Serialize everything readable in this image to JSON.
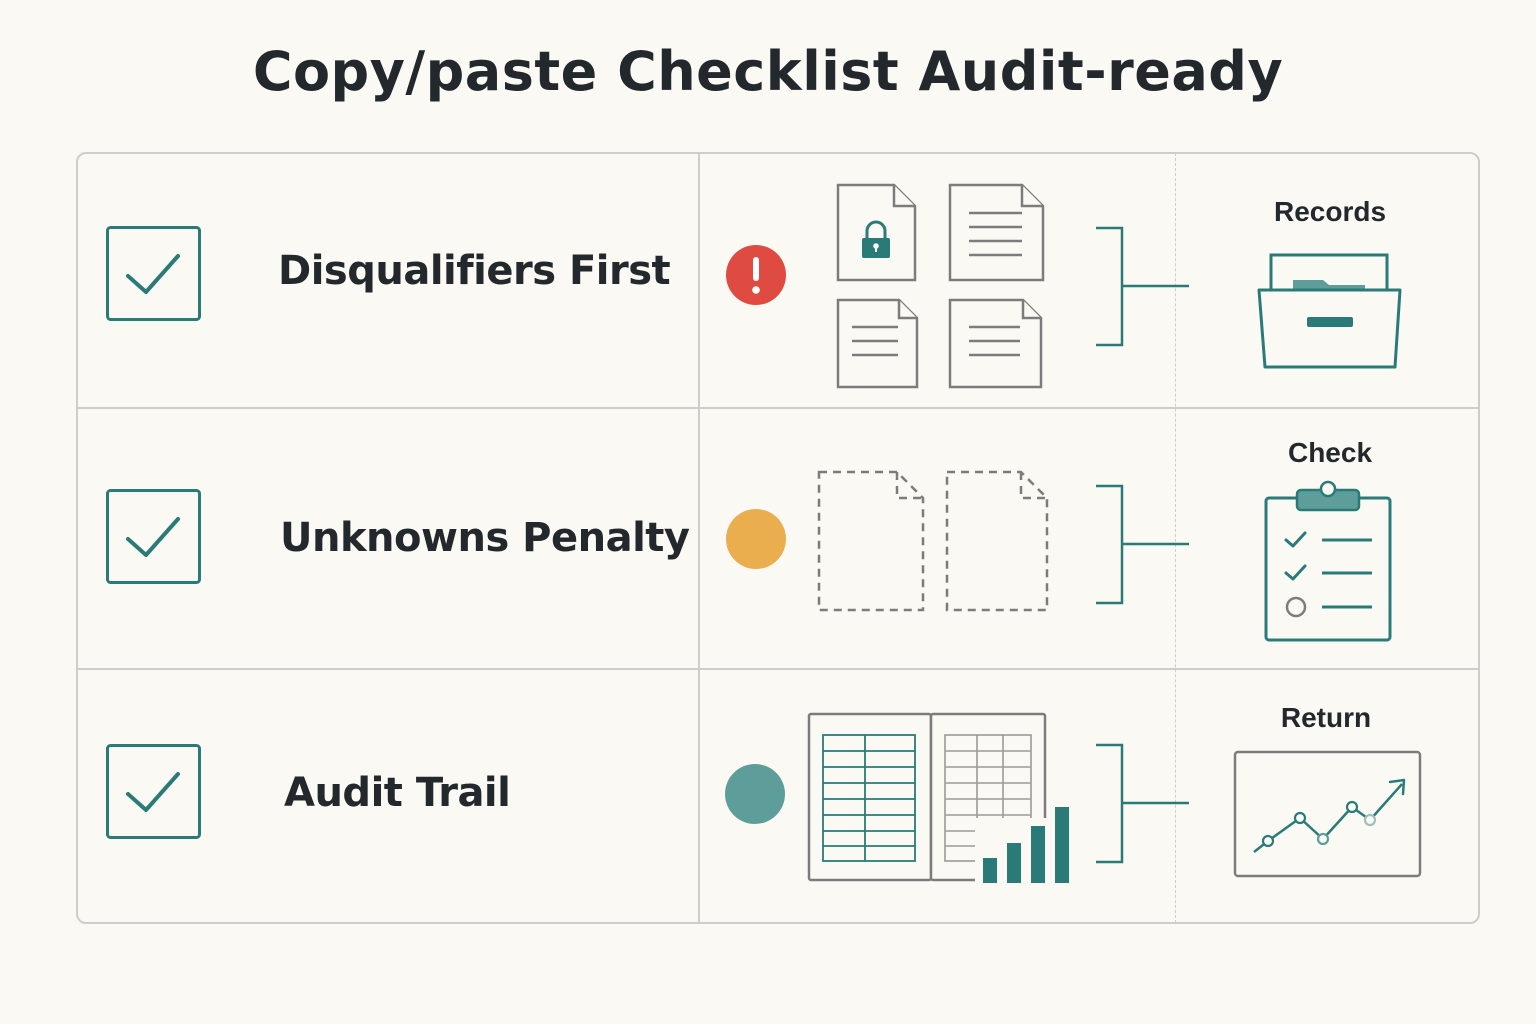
{
  "title": "Copy/paste Checklist Audit-ready",
  "colors": {
    "teal": "#2a7b78",
    "red": "#df4a41",
    "amber": "#eaae4f",
    "teal_dot": "#5e9e9a",
    "gray": "#7c7c7c",
    "border": "#cdcdcb",
    "background": "#fbf9f4"
  },
  "rows": [
    {
      "label": "Disqualifiers First",
      "checked": true,
      "status": "red",
      "status_icon": "alert-icon",
      "documents_icon": "locked-and-text-documents-icon",
      "category": "Records",
      "category_icon": "open-file-box-icon"
    },
    {
      "label": "Unknowns Penalty",
      "checked": true,
      "status": "amber",
      "status_icon": "status-dot",
      "documents_icon": "missing-documents-icon",
      "category": "Check",
      "category_icon": "clipboard-checklist-icon"
    },
    {
      "label": "Audit Trail",
      "checked": true,
      "status": "teal",
      "status_icon": "status-dot",
      "documents_icon": "ledger-with-bar-chart-icon",
      "category": "Return",
      "category_icon": "trend-chart-icon"
    }
  ]
}
